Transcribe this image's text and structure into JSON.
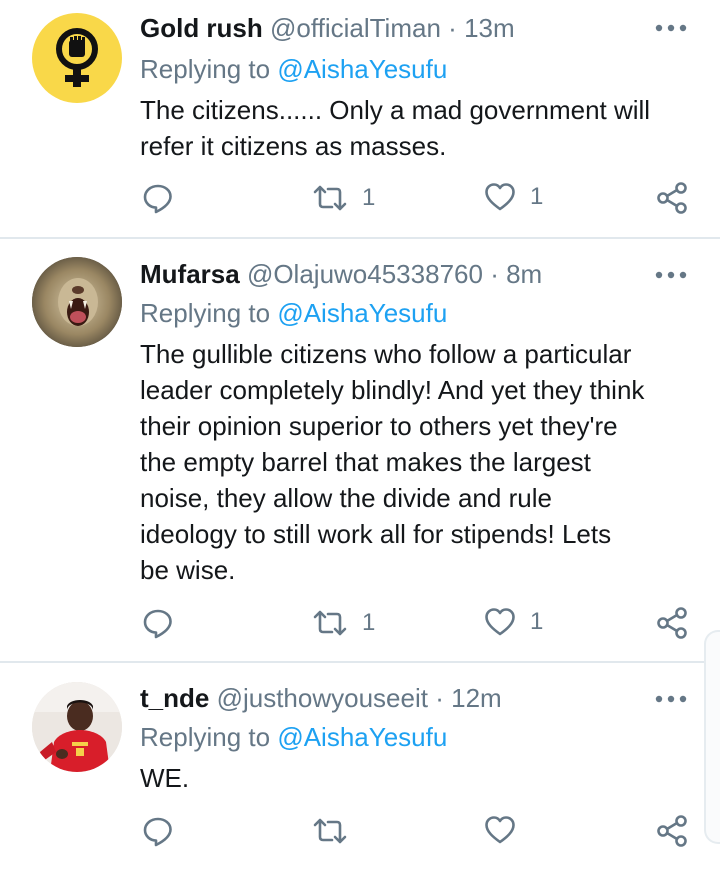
{
  "tweets": [
    {
      "name": "Gold rush",
      "handle": "@officialTiman",
      "dot": "·",
      "time": "13m",
      "replying_prefix": "Replying to ",
      "replying_to": "@AishaYesufu",
      "text_lines": [
        "The citizens...... Only a mad government will",
        "refer it citizens as masses."
      ],
      "retweets": "1",
      "likes": "1",
      "avatar": "fist-in-venus-symbol",
      "avatar_bg": "#f9d849"
    },
    {
      "name": "Mufarsa",
      "handle": "@Olajuwo45338760",
      "dot": "·",
      "time": "8m",
      "replying_prefix": "Replying to ",
      "replying_to": "@AishaYesufu",
      "text_lines": [
        "The gullible citizens who follow a particular",
        "leader completely blindly! And yet they think",
        "their opinion superior to others yet they're",
        "the empty barrel that makes the largest",
        "noise, they allow the divide and rule",
        "ideology to still work all for stipends! Lets",
        "be wise."
      ],
      "retweets": "1",
      "likes": "1",
      "avatar": "roaring-lion-photo"
    },
    {
      "name": "t_nde",
      "handle": "@justhowyouseeit",
      "dot": "·",
      "time": "12m",
      "replying_prefix": "Replying to ",
      "replying_to": "@AishaYesufu",
      "text_lines": [
        "WE."
      ],
      "retweets": "",
      "likes": "",
      "avatar": "man-in-red-jersey-photo"
    }
  ],
  "colors": {
    "link": "#1da1f2",
    "secondary": "#657786",
    "primary": "#14171a",
    "divider": "#e1e8ed"
  },
  "icons": [
    "reply-icon",
    "retweet-icon",
    "like-icon",
    "share-icon",
    "more-icon"
  ]
}
